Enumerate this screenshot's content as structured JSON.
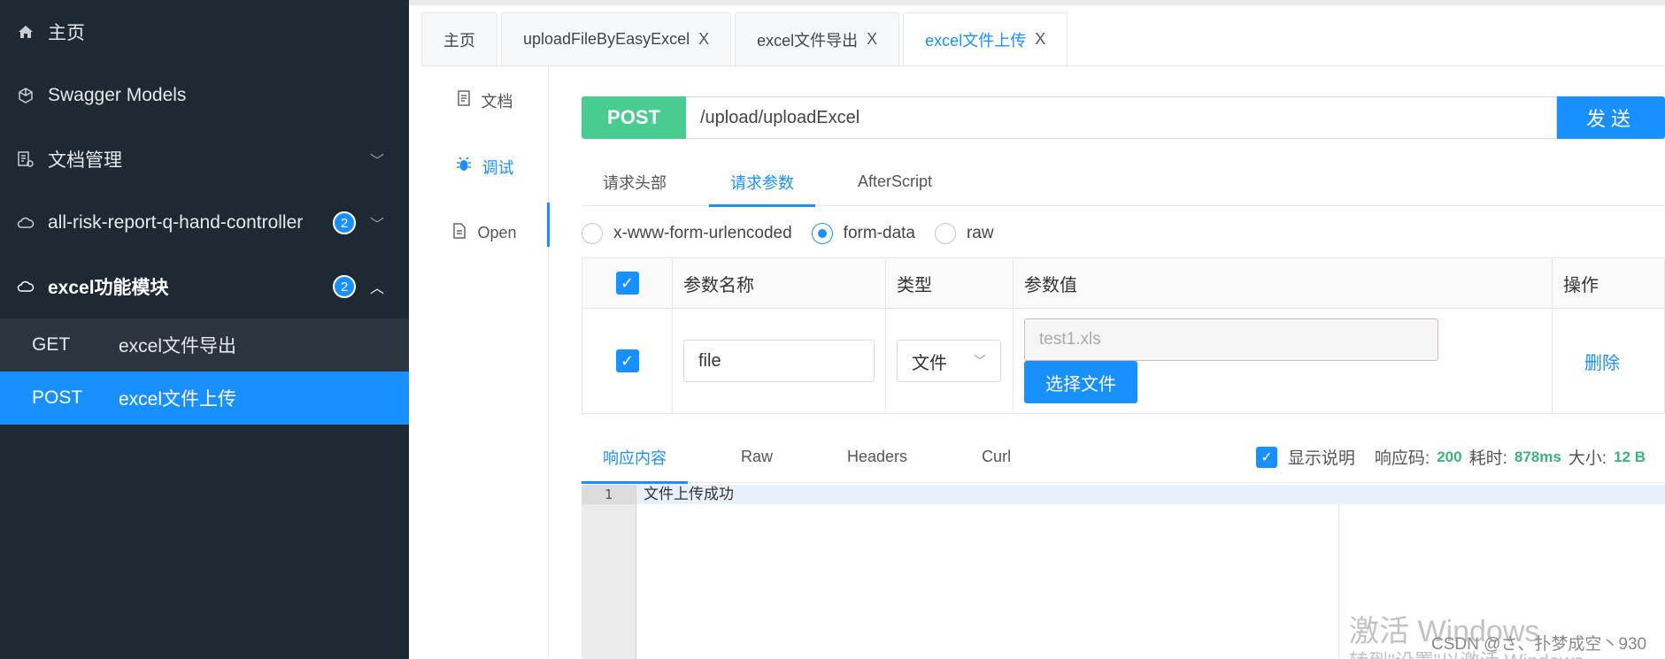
{
  "sidebar": {
    "items": [
      {
        "label": "主页"
      },
      {
        "label": "Swagger Models"
      },
      {
        "label": "文档管理"
      },
      {
        "label": "all-risk-report-q-hand-controller",
        "badge": "2"
      },
      {
        "label": "excel功能模块",
        "badge": "2"
      }
    ],
    "sub_items": [
      {
        "method": "GET",
        "label": "excel文件导出"
      },
      {
        "method": "POST",
        "label": "excel文件上传"
      }
    ]
  },
  "tabs": [
    {
      "label": "主页"
    },
    {
      "label": "uploadFileByEasyExcel",
      "close": "X"
    },
    {
      "label": "excel文件导出",
      "close": "X"
    },
    {
      "label": "excel文件上传",
      "close": "X"
    }
  ],
  "vnav": [
    {
      "label": "文档"
    },
    {
      "label": "调试"
    },
    {
      "label": "Open"
    }
  ],
  "request": {
    "method": "POST",
    "url": "/upload/uploadExcel",
    "send_label": "发送"
  },
  "req_tabs": [
    "请求头部",
    "请求参数",
    "AfterScript"
  ],
  "body_types": [
    "x-www-form-urlencoded",
    "form-data",
    "raw"
  ],
  "params_table": {
    "headers": [
      "参数名称",
      "类型",
      "参数值",
      "操作"
    ],
    "row": {
      "name": "file",
      "type": "文件",
      "value_placeholder": "test1.xls",
      "choose_file_label": "选择文件",
      "action": "删除"
    }
  },
  "response": {
    "tabs": [
      "响应内容",
      "Raw",
      "Headers",
      "Curl"
    ],
    "show_desc_label": "显示说明",
    "code_label": "响应码:",
    "code": "200",
    "time_label": "耗时:",
    "time": "878ms",
    "size_label": "大小:",
    "size": "12 B",
    "line_number": "1",
    "body": "文件上传成功"
  },
  "watermark": {
    "line1": "激活 Windows",
    "line2": "转到\"设置\"以激活 Windows。",
    "csdn": "CSDN @さ、扑梦成空丶930"
  }
}
